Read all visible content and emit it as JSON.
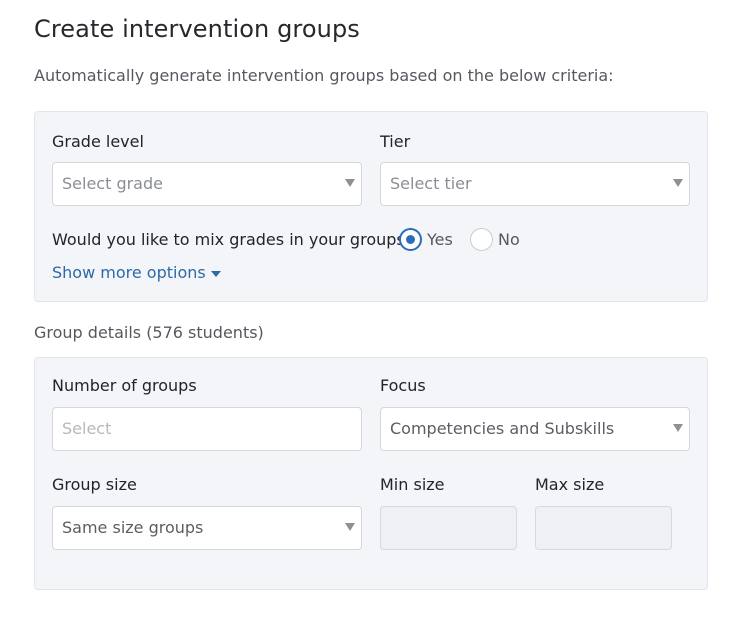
{
  "page": {
    "title": "Create intervention groups",
    "subtitle": "Automatically generate intervention groups based on the below criteria:"
  },
  "criteria": {
    "grade_level": {
      "label": "Grade level",
      "placeholder": "Select grade",
      "icon": "caret-down-icon"
    },
    "tier": {
      "label": "Tier",
      "placeholder": "Select tier",
      "icon": "caret-down-icon"
    },
    "mix_grades": {
      "question": "Would you like to mix grades in your groups:",
      "options": [
        {
          "label": "Yes",
          "checked": true
        },
        {
          "label": "No",
          "checked": false
        }
      ]
    },
    "show_more": {
      "label": "Show more options",
      "icon": "caret-down-icon"
    }
  },
  "group_details": {
    "title": "Group details (576 students)",
    "number_of_groups": {
      "label": "Number of groups",
      "placeholder": "Select"
    },
    "focus": {
      "label": "Focus",
      "value": "Competencies and Subskills",
      "icon": "caret-down-icon"
    },
    "group_size": {
      "label": "Group size",
      "value": "Same size groups",
      "icon": "caret-down-icon"
    },
    "min_size": {
      "label": "Min size",
      "value": ""
    },
    "max_size": {
      "label": "Max size",
      "value": ""
    }
  },
  "colors": {
    "accent": "#2c6db8",
    "link": "#2d6aa6",
    "panel_bg": "#f4f5f8",
    "panel_border": "#e3e5ea"
  }
}
